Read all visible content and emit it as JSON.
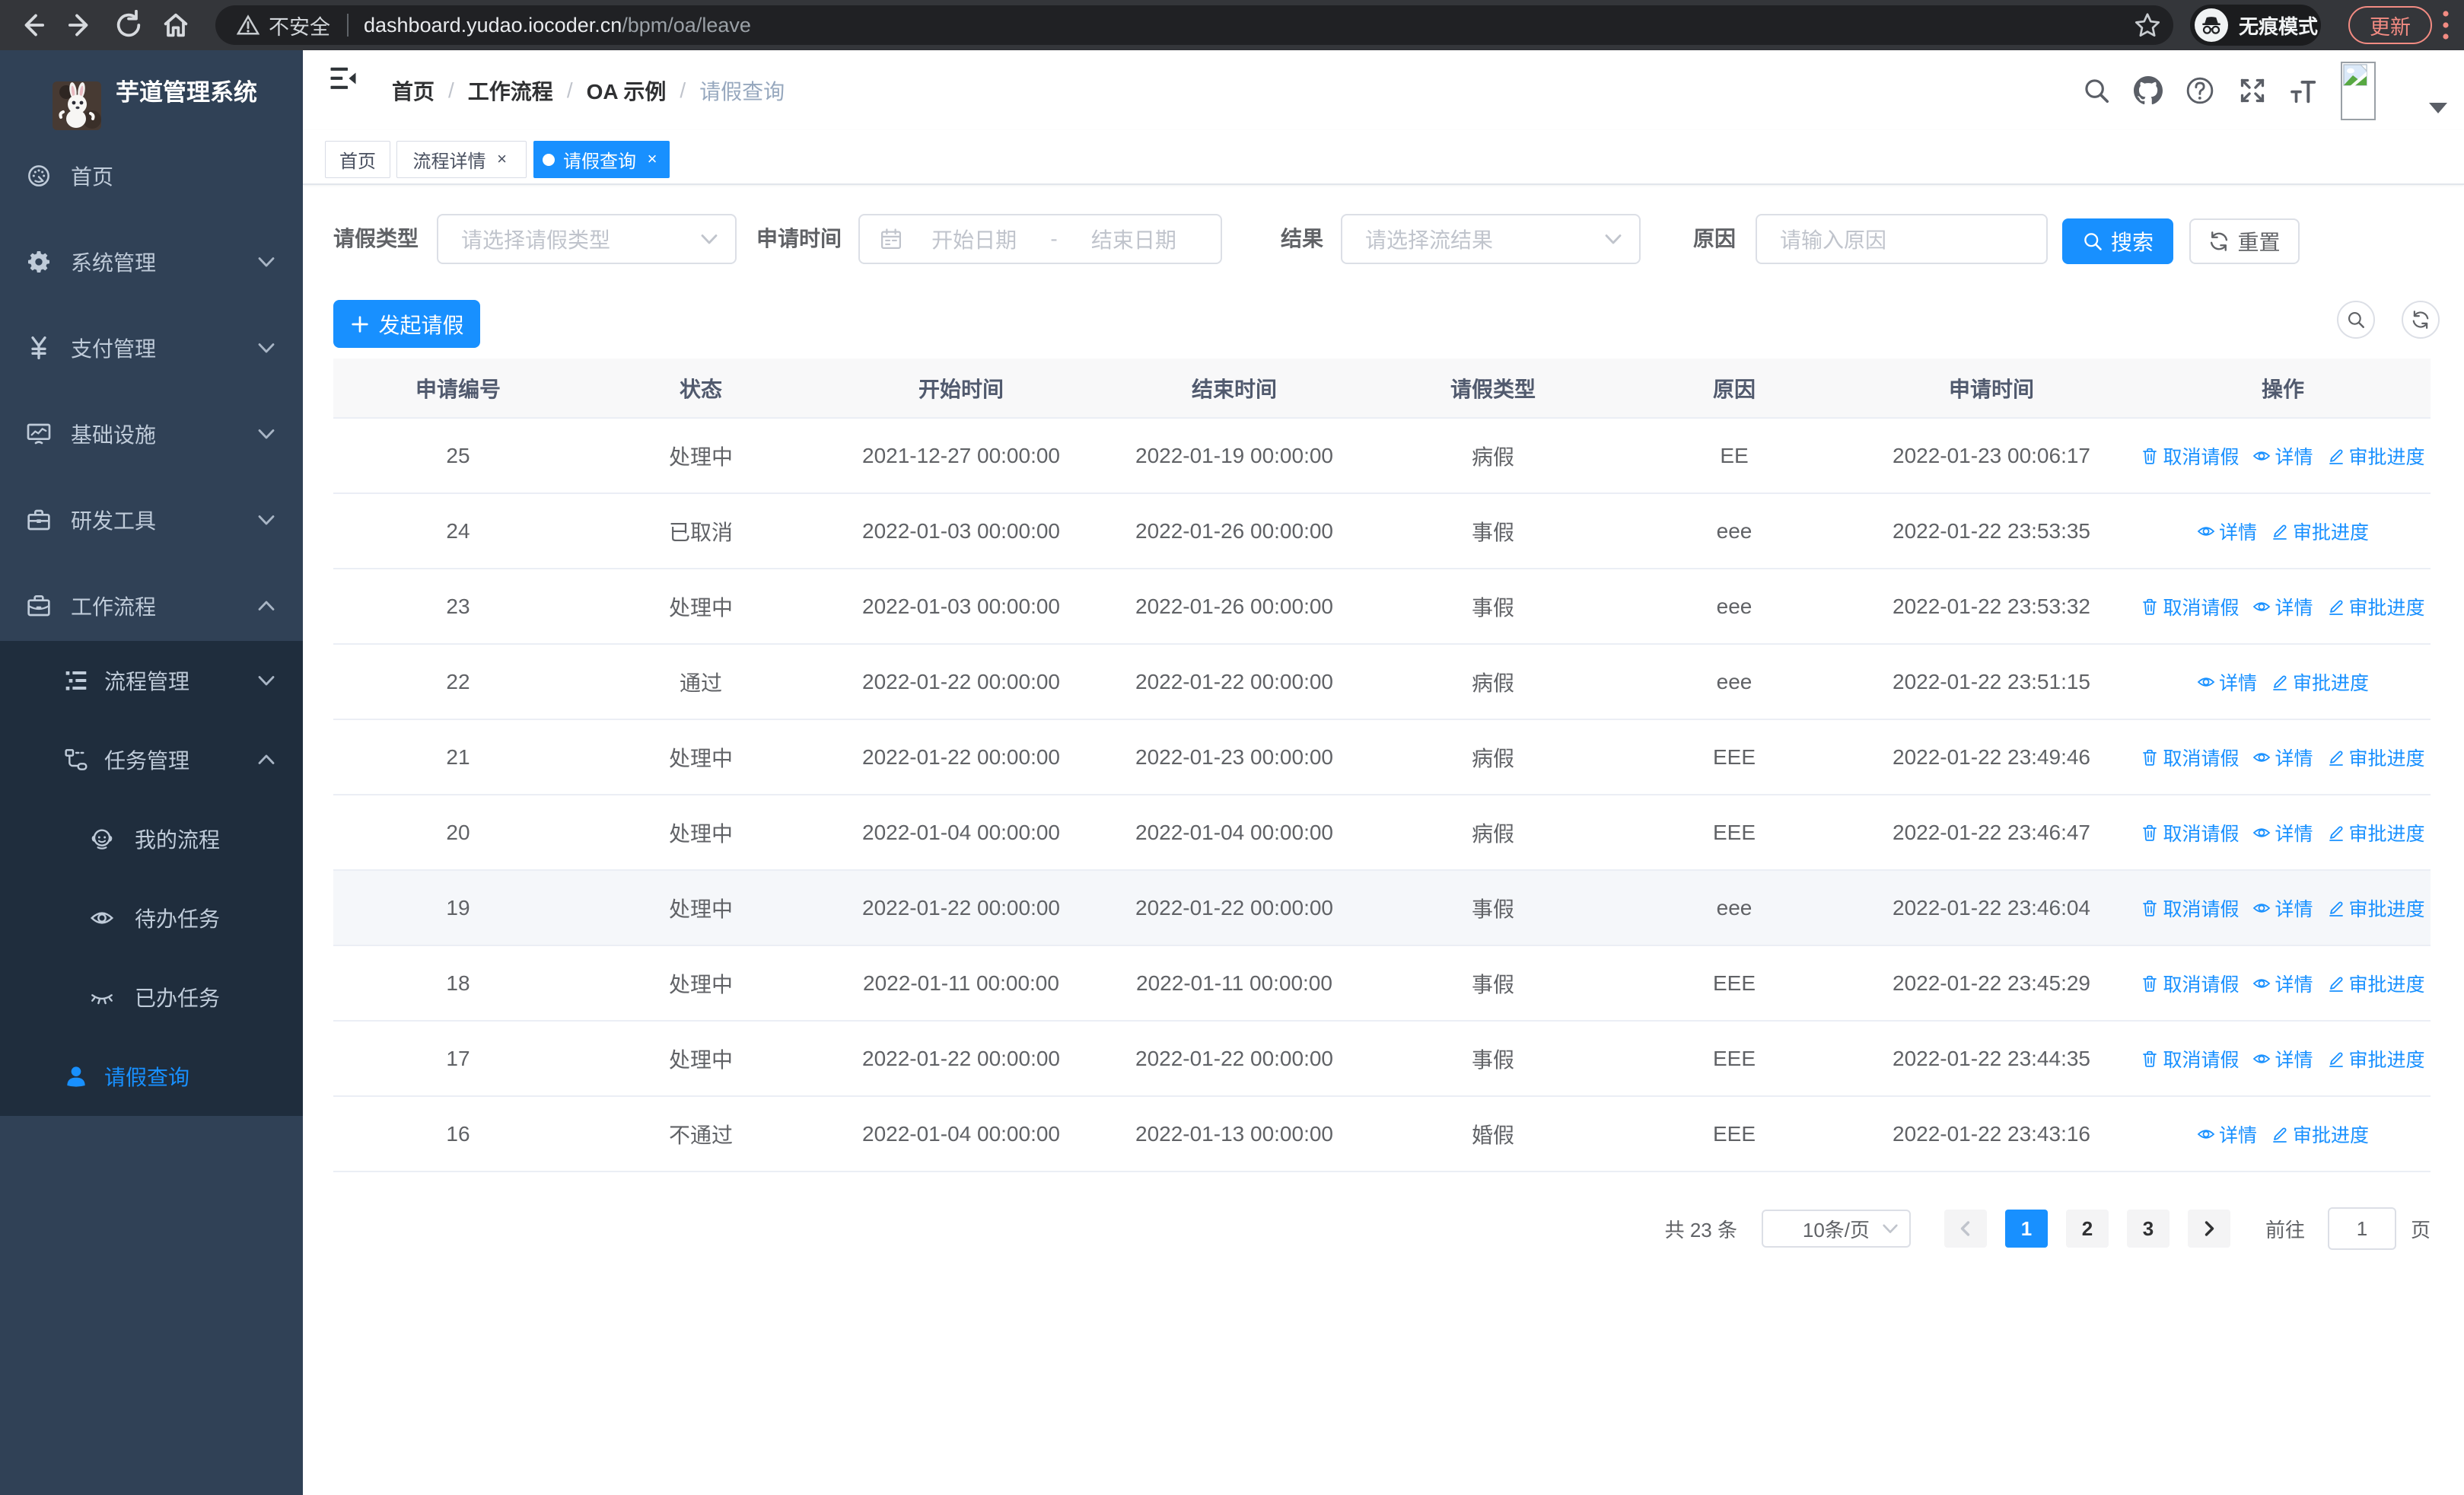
{
  "accent_color": "#1890ff",
  "browser": {
    "security_label": "不安全",
    "url_host": "dashboard.yudao.iocoder.cn",
    "url_path": "/bpm/oa/leave",
    "incognito_label": "无痕模式",
    "update_label": "更新"
  },
  "sidebar": {
    "logo_title": "芋道管理系统",
    "menu_main": [
      {
        "label": "首页",
        "icon": "dashboard-icon"
      },
      {
        "label": "系统管理",
        "icon": "gear-icon",
        "arrow": "down"
      },
      {
        "label": "支付管理",
        "icon": "yuan-icon",
        "arrow": "down"
      },
      {
        "label": "基础设施",
        "icon": "monitor-icon",
        "arrow": "down"
      },
      {
        "label": "研发工具",
        "icon": "toolbox-icon",
        "arrow": "down"
      },
      {
        "label": "工作流程",
        "icon": "briefcase-icon",
        "arrow": "up"
      }
    ],
    "menu_sub": [
      {
        "label": "流程管理",
        "icon": "tree-list-icon",
        "arrow": "down",
        "indent": 1
      },
      {
        "label": "任务管理",
        "icon": "flow-icon",
        "arrow": "up",
        "indent": 1
      },
      {
        "label": "我的流程",
        "icon": "people-icon",
        "indent": 2
      },
      {
        "label": "待办任务",
        "icon": "eye-open-icon",
        "indent": 2
      },
      {
        "label": "已办任务",
        "icon": "eye-closed-icon",
        "indent": 2
      },
      {
        "label": "请假查询",
        "icon": "user-icon",
        "indent": 1,
        "active": true
      }
    ]
  },
  "navbar": {
    "breadcrumb": [
      {
        "label": "首页"
      },
      {
        "label": "工作流程"
      },
      {
        "label": "OA 示例"
      },
      {
        "label": "请假查询"
      }
    ]
  },
  "tags": [
    {
      "label": "首页"
    },
    {
      "label": "流程详情"
    },
    {
      "label": "请假查询"
    }
  ],
  "close_glyph": "×",
  "filters": {
    "leave_type_label": "请假类型",
    "leave_type_placeholder": "请选择请假类型",
    "apply_time_label": "申请时间",
    "start_date_placeholder": "开始日期",
    "date_separator": "-",
    "end_date_placeholder": "结束日期",
    "result_label": "结果",
    "result_placeholder": "请选择流结果",
    "reason_label": "原因",
    "reason_placeholder": "请输入原因",
    "search_label": "搜索",
    "reset_label": "重置"
  },
  "toolbar": {
    "create_label": "发起请假"
  },
  "table": {
    "columns": [
      "申请编号",
      "状态",
      "开始时间",
      "结束时间",
      "请假类型",
      "原因",
      "申请时间",
      "操作"
    ],
    "action_cancel_label": "取消请假",
    "action_detail_label": "详情",
    "action_progress_label": "审批进度",
    "rows": [
      {
        "id": "25",
        "status": "处理中",
        "start": "2021-12-27 00:00:00",
        "end": "2022-01-19 00:00:00",
        "type": "病假",
        "reason": "EE",
        "time": "2022-01-23 00:06:17",
        "can_cancel": true
      },
      {
        "id": "24",
        "status": "已取消",
        "start": "2022-01-03 00:00:00",
        "end": "2022-01-26 00:00:00",
        "type": "事假",
        "reason": "eee",
        "time": "2022-01-22 23:53:35",
        "can_cancel": false
      },
      {
        "id": "23",
        "status": "处理中",
        "start": "2022-01-03 00:00:00",
        "end": "2022-01-26 00:00:00",
        "type": "事假",
        "reason": "eee",
        "time": "2022-01-22 23:53:32",
        "can_cancel": true
      },
      {
        "id": "22",
        "status": "通过",
        "start": "2022-01-22 00:00:00",
        "end": "2022-01-22 00:00:00",
        "type": "病假",
        "reason": "eee",
        "time": "2022-01-22 23:51:15",
        "can_cancel": false
      },
      {
        "id": "21",
        "status": "处理中",
        "start": "2022-01-22 00:00:00",
        "end": "2022-01-23 00:00:00",
        "type": "病假",
        "reason": "EEE",
        "time": "2022-01-22 23:49:46",
        "can_cancel": true
      },
      {
        "id": "20",
        "status": "处理中",
        "start": "2022-01-04 00:00:00",
        "end": "2022-01-04 00:00:00",
        "type": "病假",
        "reason": "EEE",
        "time": "2022-01-22 23:46:47",
        "can_cancel": true
      },
      {
        "id": "19",
        "status": "处理中",
        "start": "2022-01-22 00:00:00",
        "end": "2022-01-22 00:00:00",
        "type": "事假",
        "reason": "eee",
        "time": "2022-01-22 23:46:04",
        "can_cancel": true,
        "hovered": true
      },
      {
        "id": "18",
        "status": "处理中",
        "start": "2022-01-11 00:00:00",
        "end": "2022-01-11 00:00:00",
        "type": "事假",
        "reason": "EEE",
        "time": "2022-01-22 23:45:29",
        "can_cancel": true
      },
      {
        "id": "17",
        "status": "处理中",
        "start": "2022-01-22 00:00:00",
        "end": "2022-01-22 00:00:00",
        "type": "事假",
        "reason": "EEE",
        "time": "2022-01-22 23:44:35",
        "can_cancel": true
      },
      {
        "id": "16",
        "status": "不通过",
        "start": "2022-01-04 00:00:00",
        "end": "2022-01-13 00:00:00",
        "type": "婚假",
        "reason": "EEE",
        "time": "2022-01-22 23:43:16",
        "can_cancel": false
      }
    ]
  },
  "pagination": {
    "total_label": "共 23 条",
    "page_size_label": "10条/页",
    "pages": [
      "1",
      "2",
      "3"
    ],
    "active_page": "1",
    "goto_label": "前往",
    "goto_value": "1",
    "page_suffix_label": "页"
  }
}
